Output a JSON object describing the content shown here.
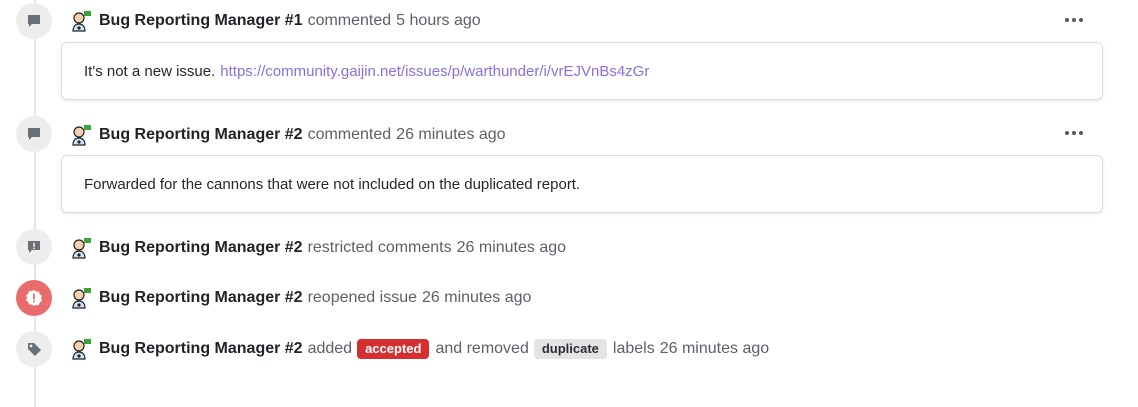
{
  "events": [
    {
      "type": "comment",
      "icon": "speech-bubble-icon",
      "author": "Bug Reporting Manager #1",
      "verb": "commented",
      "time": "5 hours ago",
      "body_text": "It's not a new issue.",
      "body_link": "https://community.gaijin.net/issues/p/warthunder/i/vrEJVnBs4zGr"
    },
    {
      "type": "comment",
      "icon": "speech-bubble-icon",
      "author": "Bug Reporting Manager #2",
      "verb": "commented",
      "time": "26 minutes ago",
      "body_text": "Forwarded for the cannons that were not included on the duplicated report."
    },
    {
      "type": "event",
      "icon": "restricted-comment-icon",
      "author": "Bug Reporting Manager #2",
      "verb": "restricted comments",
      "time": "26 minutes ago"
    },
    {
      "type": "event",
      "icon": "reopened-alert-icon",
      "author": "Bug Reporting Manager #2",
      "verb": "reopened issue",
      "time": "26 minutes ago"
    },
    {
      "type": "labels",
      "icon": "tag-icon",
      "author": "Bug Reporting Manager #2",
      "verb_added": "added",
      "added_label": "accepted",
      "verb_removed": "and removed",
      "removed_label": "duplicate",
      "suffix": "labels",
      "time": "26 minutes ago"
    }
  ],
  "colors": {
    "accepted_label_bg": "#d62f2f",
    "duplicate_label_bg": "#e4e4e6",
    "reopened_badge_bg": "#e96b6b",
    "link": "#8b6fe0"
  }
}
